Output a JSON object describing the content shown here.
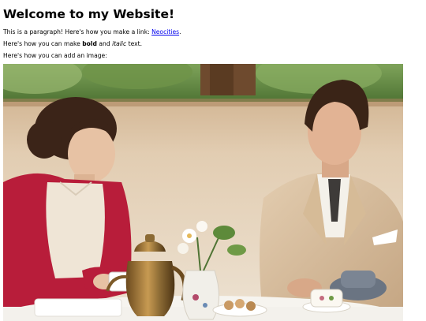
{
  "page": {
    "heading": "Welcome to my Website!",
    "para1": {
      "text": "This is a paragraph! Here's how you make a link: ",
      "link_text": "Neocities",
      "end": "."
    },
    "para2": {
      "before": "Here's how you can make ",
      "bold": "bold",
      "middle": " and ",
      "italic": "italic",
      "after": " text."
    },
    "para3": {
      "text": "Here's how you can add an image:"
    }
  },
  "colors": {
    "link": "#0000ee",
    "text": "#000000",
    "background": "#ffffff"
  }
}
